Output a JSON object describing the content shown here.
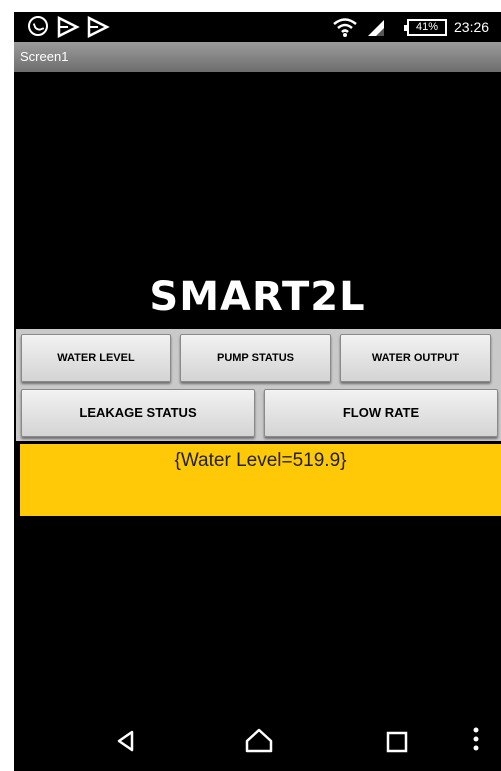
{
  "status_bar": {
    "battery": "41%",
    "time": "23:26"
  },
  "title_bar": {
    "title": "Screen1"
  },
  "app": {
    "title": "SMART2L"
  },
  "buttons": {
    "water_level": "WATER LEVEL",
    "pump_status": "PUMP STATUS",
    "water_output": "WATER OUTPUT",
    "leakage_status": "LEAKAGE STATUS",
    "flow_rate": "FLOW RATE"
  },
  "result": {
    "text": "{Water Level=519.9}"
  },
  "colors": {
    "result_background": "#ffc907",
    "screen_background": "#000000",
    "button_panel": "#c9c9c9"
  },
  "icons": {
    "status": [
      "whatsapp-icon",
      "play-store-icon",
      "play-store-icon",
      "wifi-icon",
      "signal-icon",
      "battery-icon"
    ],
    "navigation": [
      "back-icon",
      "home-icon",
      "recents-icon",
      "overflow-menu-icon"
    ]
  }
}
